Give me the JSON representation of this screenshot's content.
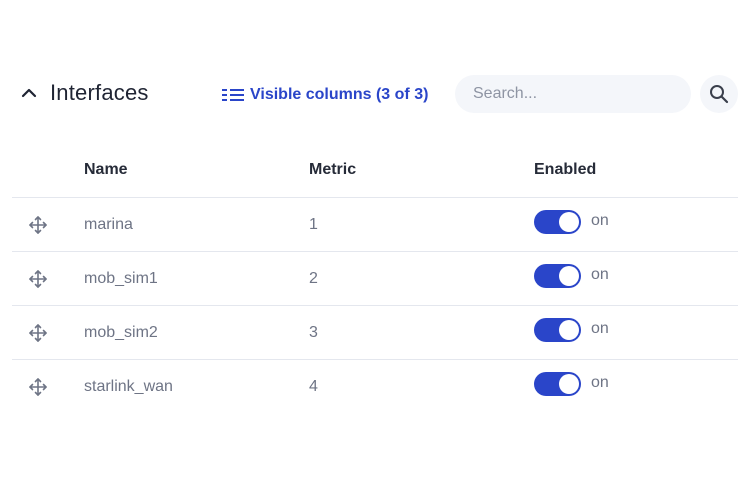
{
  "section": {
    "title": "Interfaces",
    "visible_columns_label": "Visible columns (3 of 3)"
  },
  "search": {
    "placeholder": "Search...",
    "value": ""
  },
  "table": {
    "columns": [
      "Name",
      "Metric",
      "Enabled"
    ],
    "rows": [
      {
        "name": "marina",
        "metric": "1",
        "enabled": true,
        "enabled_label": "on"
      },
      {
        "name": "mob_sim1",
        "metric": "2",
        "enabled": true,
        "enabled_label": "on"
      },
      {
        "name": "mob_sim2",
        "metric": "3",
        "enabled": true,
        "enabled_label": "on"
      },
      {
        "name": "starlink_wan",
        "metric": "4",
        "enabled": true,
        "enabled_label": "on"
      }
    ]
  },
  "icons": {
    "collapse": "chevron-up-icon",
    "columns": "columns-list-icon",
    "search": "search-icon",
    "drag": "move-arrows-icon"
  },
  "colors": {
    "accent": "#2a45c9",
    "text": "#1f2433",
    "muted": "#6e7485",
    "input_bg": "#f4f6fa",
    "divider": "#e4e7ee"
  }
}
